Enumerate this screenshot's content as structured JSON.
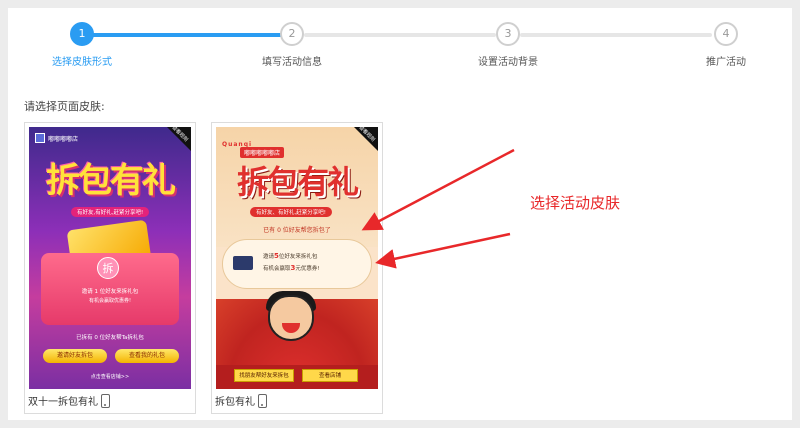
{
  "steps": [
    {
      "num": "1",
      "label": "选择皮肤形式"
    },
    {
      "num": "2",
      "label": "填写活动信息"
    },
    {
      "num": "3",
      "label": "设置活动背景"
    },
    {
      "num": "4",
      "label": "推广活动"
    }
  ],
  "active_step": 1,
  "prompt": "请选择页面皮肤:",
  "skins": [
    {
      "caption": "双十一拆包有礼",
      "preview": {
        "shop_name": "嘟嘟嘟嘟店",
        "corner_badge": "查看规则",
        "headline": "拆包有礼",
        "subline": "有好友,有好礼,赶紧分享吧!",
        "seal": "拆",
        "invite_text": "邀请 1 位好友来拆礼包",
        "reward_text": "有机会赢取优惠券!",
        "cut_count": "已拆有 0 位好友帮Ta拆礼包",
        "btn_invite": "邀请好友拆包",
        "btn_gift": "查看我的礼包",
        "footer": "点击查看店铺>>"
      },
      "accent": "#8d2fb8"
    },
    {
      "caption": "拆包有礼",
      "preview": {
        "brand": "Quanqi",
        "shop_name": "嘟嘟嘟嘟嘟店",
        "corner_badge": "查看规则",
        "headline": "拆包有礼",
        "subline": "有好友、有好礼,赶紧分享吧!",
        "got_text": "已有 0 位好友帮您拆包了",
        "invite_pre": "邀请",
        "invite_num": "5",
        "invite_post": "位好友来拆礼包",
        "reward_pre": "有机会赢取",
        "reward_num": "3",
        "reward_post": "元优惠券!",
        "btn_invite": "找朋友帮好友来拆包",
        "btn_shop": "查看店铺"
      },
      "accent": "#e0302e"
    }
  ],
  "annotation": "选择活动皮肤",
  "colors": {
    "primary": "#2a9cf2",
    "annotation": "#e8282a"
  },
  "icons": {
    "caption_icon": "mobile-phone-icon"
  }
}
